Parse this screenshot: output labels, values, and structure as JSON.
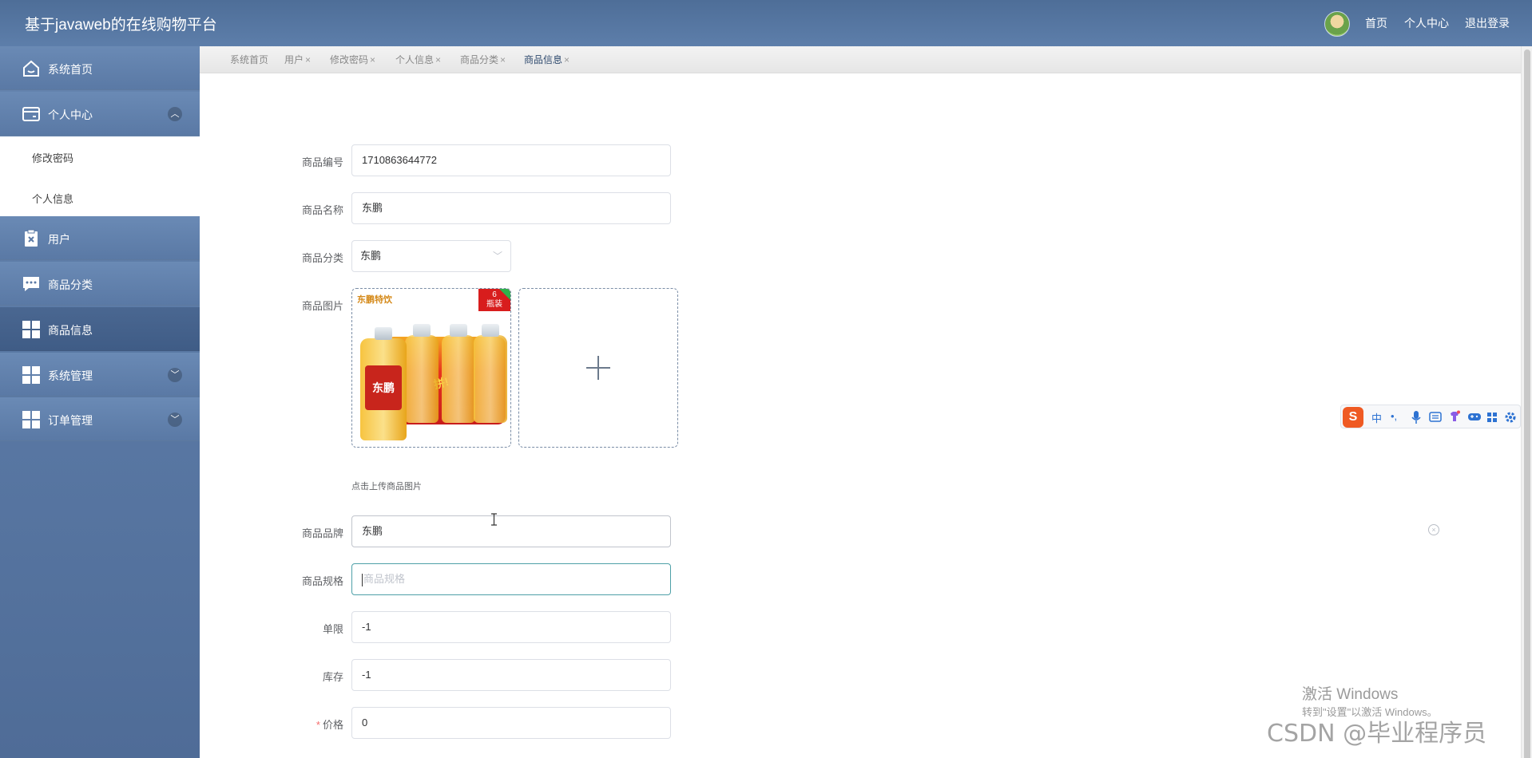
{
  "header": {
    "title": "基于javaweb的在线购物平台",
    "nav": {
      "home": "首页",
      "profile": "个人中心",
      "logout": "退出登录"
    }
  },
  "sidebar": {
    "items": [
      {
        "label": "系统首页",
        "icon": "home-icon"
      },
      {
        "label": "个人中心",
        "icon": "card-icon",
        "expanded": true
      },
      {
        "label": "用户",
        "icon": "clipboard-icon"
      },
      {
        "label": "商品分类",
        "icon": "chat-icon"
      },
      {
        "label": "商品信息",
        "icon": "grid-icon",
        "active": true
      },
      {
        "label": "系统管理",
        "icon": "grid-icon"
      },
      {
        "label": "订单管理",
        "icon": "grid-icon"
      }
    ],
    "submenu": {
      "change_password": "修改密码",
      "personal_info": "个人信息"
    }
  },
  "tabs": [
    {
      "label": "系统首页",
      "closable": false
    },
    {
      "label": "用户",
      "closable": true
    },
    {
      "label": "修改密码",
      "closable": true
    },
    {
      "label": "个人信息",
      "closable": true
    },
    {
      "label": "商品分类",
      "closable": true
    },
    {
      "label": "商品信息",
      "closable": true,
      "active": true
    }
  ],
  "tab_close": "×",
  "form": {
    "product_no": {
      "label": "商品编号",
      "value": "1710863644772"
    },
    "product_name": {
      "label": "商品名称",
      "value": "东鹏"
    },
    "category": {
      "label": "商品分类",
      "value": "东鹏"
    },
    "image": {
      "label": "商品图片",
      "tip": "点击上传商品图片",
      "picture": {
        "brand_logo": "东鹏特饮",
        "badge_count": "6",
        "badge_unit": "瓶装",
        "bottle_text": "东鹏",
        "slogan": "拼!"
      }
    },
    "brand": {
      "label": "商品品牌",
      "value": "东鹏"
    },
    "spec": {
      "label": "商品规格",
      "placeholder": "商品规格"
    },
    "limit": {
      "label": "单限",
      "value": "-1"
    },
    "stock": {
      "label": "库存",
      "value": "-1"
    },
    "price": {
      "label": "价格",
      "required_mark": "*",
      "value": "0"
    }
  },
  "ime_toolbar": {
    "logo": "S",
    "mode": "中",
    "punct": "•,"
  },
  "os_watermark": {
    "line1": "激活 Windows",
    "line2": "转到\"设置\"以激活 Windows。"
  },
  "csdn_watermark": "CSDN @毕业程序员",
  "colors": {
    "header": "#5a7aa6",
    "sidebar": "#5b7aa6",
    "active_menu": "#44618b",
    "focus_border": "#4ea0a8"
  }
}
